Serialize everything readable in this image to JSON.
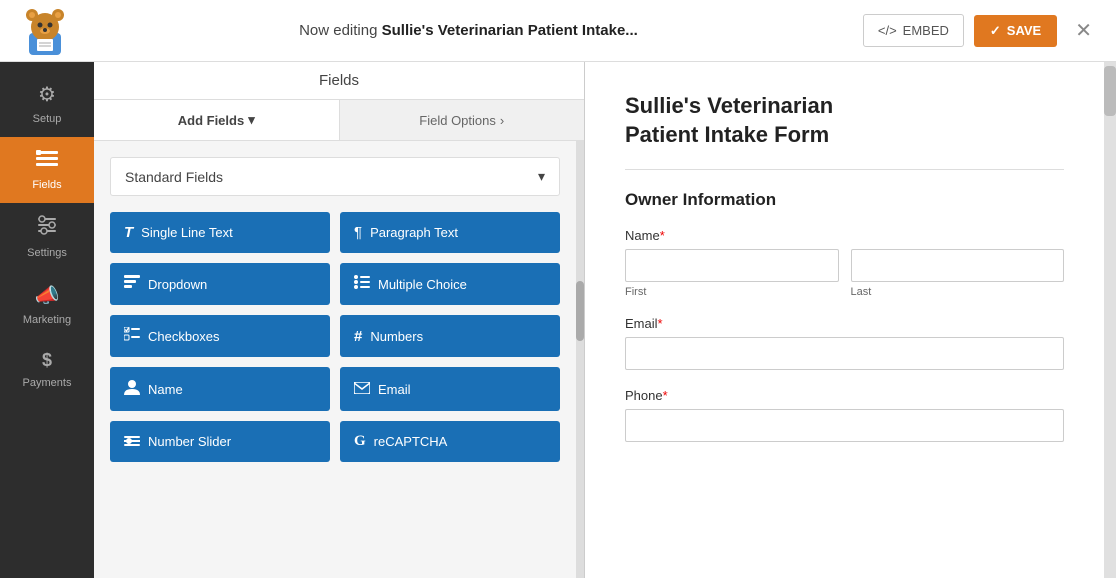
{
  "topBar": {
    "editingLabel": "Now editing",
    "formName": "Sullie's Veterinarian Patient Intake...",
    "embedLabel": "EMBED",
    "saveLabel": "SAVE",
    "closeLabel": "✕"
  },
  "sidebar": {
    "items": [
      {
        "id": "setup",
        "label": "Setup",
        "icon": "⚙"
      },
      {
        "id": "fields",
        "label": "Fields",
        "icon": "☰",
        "active": true
      },
      {
        "id": "settings",
        "label": "Settings",
        "icon": "≡"
      },
      {
        "id": "marketing",
        "label": "Marketing",
        "icon": "📣"
      },
      {
        "id": "payments",
        "label": "Payments",
        "icon": "$"
      }
    ]
  },
  "fieldsPanel": {
    "panelTitle": "Fields",
    "tabs": [
      {
        "id": "add-fields",
        "label": "Add Fields",
        "chevron": "▾"
      },
      {
        "id": "field-options",
        "label": "Field Options",
        "chevron": "›"
      }
    ],
    "sectionDropdown": {
      "label": "Standard Fields",
      "chevron": "▾"
    },
    "fieldButtons": [
      {
        "id": "single-line-text",
        "label": "Single Line Text",
        "icon": "T"
      },
      {
        "id": "paragraph-text",
        "label": "Paragraph Text",
        "icon": "¶"
      },
      {
        "id": "dropdown",
        "label": "Dropdown",
        "icon": "▤"
      },
      {
        "id": "multiple-choice",
        "label": "Multiple Choice",
        "icon": "≡"
      },
      {
        "id": "checkboxes",
        "label": "Checkboxes",
        "icon": "☑"
      },
      {
        "id": "numbers",
        "label": "Numbers",
        "icon": "#"
      },
      {
        "id": "name",
        "label": "Name",
        "icon": "👤"
      },
      {
        "id": "email",
        "label": "Email",
        "icon": "✉"
      },
      {
        "id": "number-slider",
        "label": "Number Slider",
        "icon": "⊟"
      },
      {
        "id": "recaptcha",
        "label": "reCAPTCHA",
        "icon": "G"
      }
    ]
  },
  "formPreview": {
    "title": "Sullie's Veterinarian\nPatient Intake Form",
    "sections": [
      {
        "id": "owner-info",
        "sectionLabel": "Owner Information",
        "fields": [
          {
            "id": "name",
            "label": "Name",
            "required": true,
            "type": "name",
            "subfields": [
              {
                "id": "first",
                "placeholder": "",
                "sublabel": "First"
              },
              {
                "id": "last",
                "placeholder": "",
                "sublabel": "Last"
              }
            ]
          },
          {
            "id": "email",
            "label": "Email",
            "required": true,
            "type": "text",
            "placeholder": ""
          },
          {
            "id": "phone",
            "label": "Phone",
            "required": true,
            "type": "text",
            "placeholder": ""
          }
        ]
      }
    ]
  }
}
